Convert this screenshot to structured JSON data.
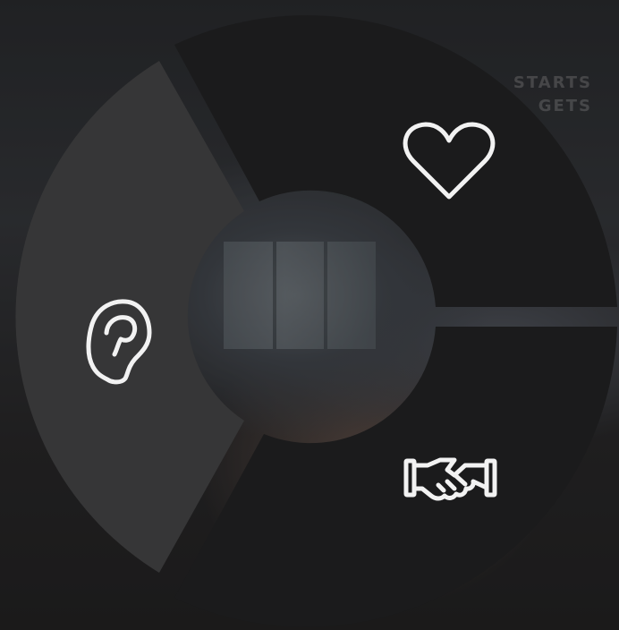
{
  "background": {
    "sign_lines": [
      "STARTS",
      "GETS"
    ]
  },
  "colors": {
    "segment_active": "#363637",
    "segment_default": "#1b1b1c",
    "icon_stroke": "#f2f2f2"
  },
  "radial_menu": {
    "segments": [
      {
        "id": "listen",
        "icon": "ear-icon",
        "selected": true
      },
      {
        "id": "love",
        "icon": "heart-icon",
        "selected": false
      },
      {
        "id": "agree",
        "icon": "handshake-icon",
        "selected": false
      }
    ]
  }
}
